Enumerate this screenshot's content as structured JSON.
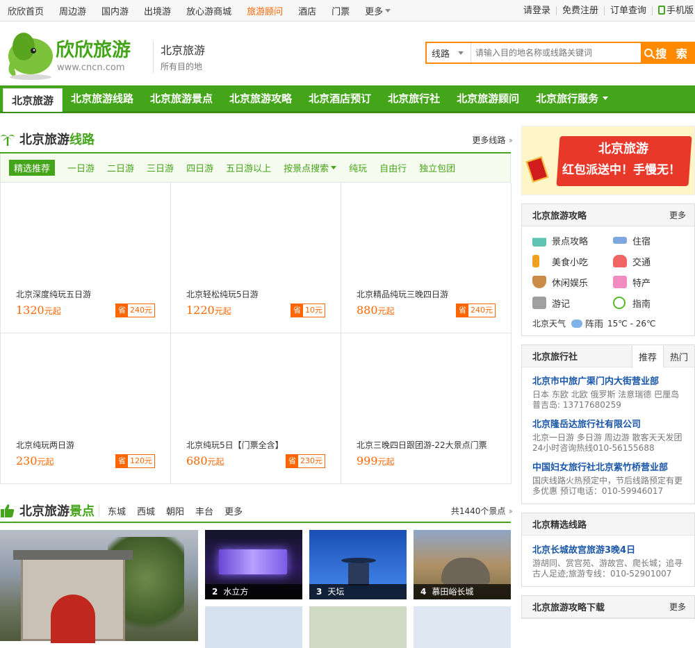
{
  "topnav": {
    "items": [
      "欣欣首页",
      "周边游",
      "国内游",
      "出境游",
      "放心游商城",
      "旅游顾问",
      "酒店",
      "门票"
    ],
    "highlight_index": 5,
    "more": "更多",
    "links": [
      "请登录",
      "免费注册",
      "订单查询",
      "手机版"
    ]
  },
  "header": {
    "logo_text": "欣欣旅游",
    "logo_url": "www.cncn.com",
    "city": "北京旅游",
    "city_sub": "所有目的地",
    "search_type": "线路",
    "search_placeholder": "请输入目的地名称或线路关键词",
    "search_button": "搜 索"
  },
  "mainnav": [
    "北京旅游",
    "北京旅游线路",
    "北京旅游景点",
    "北京旅游攻略",
    "北京酒店预订",
    "北京旅行社",
    "北京旅游顾问",
    "北京旅行服务"
  ],
  "routes": {
    "title_a": "北京旅游",
    "title_b": "线路",
    "more": "更多线路",
    "filters": [
      "精选推荐",
      "一日游",
      "二日游",
      "三日游",
      "四日游",
      "五日游以上",
      "按景点搜索",
      "纯玩",
      "自由行",
      "独立包团"
    ],
    "items": [
      {
        "name": "北京深度纯玩五日游",
        "price": "1320",
        "unit": "元起",
        "save_label": "省",
        "save": "240元"
      },
      {
        "name": "北京轻松纯玩5日游",
        "price": "1220",
        "unit": "元起",
        "save_label": "省",
        "save": "10元"
      },
      {
        "name": "北京精品纯玩三晚四日游",
        "price": "880",
        "unit": "元起",
        "save_label": "省",
        "save": "240元"
      },
      {
        "name": "北京纯玩两日游",
        "price": "230",
        "unit": "元起",
        "save_label": "省",
        "save": "120元"
      },
      {
        "name": "北京纯玩5日【门票全含】",
        "price": "680",
        "unit": "元起",
        "save_label": "省",
        "save": "230元"
      },
      {
        "name": "北京三晚四日跟团游-22大景点门票",
        "price": "999",
        "unit": "元起",
        "save_label": "",
        "save": ""
      }
    ]
  },
  "sights": {
    "title_a": "北京旅游",
    "title_b": "景点",
    "districts": [
      "东城",
      "西城",
      "朝阳",
      "丰台",
      "更多"
    ],
    "count": "共1440个景点",
    "thumbs": [
      {
        "num": "2",
        "name": "水立方"
      },
      {
        "num": "3",
        "name": "天坛"
      },
      {
        "num": "4",
        "name": "慕田峪长城"
      }
    ]
  },
  "banner": {
    "line1": "北京旅游",
    "line2": "红包派送中！手慢无！"
  },
  "guide_box": {
    "title": "北京旅游攻略",
    "more": "更多",
    "items": [
      "景点攻略",
      "住宿",
      "美食小吃",
      "交通",
      "休闲娱乐",
      "特产",
      "游记",
      "指南"
    ],
    "weather_label": "北京天气",
    "weather": "阵雨",
    "temp": "15℃ - 26℃"
  },
  "agency_box": {
    "title": "北京旅行社",
    "tabs": [
      "推荐",
      "热门"
    ],
    "items": [
      {
        "name": "北京市中旅广渠门内大街营业部",
        "desc": "日本 东欧 北欧 俄罗斯 法意瑞德 巴厘岛 普吉岛: 13717680259"
      },
      {
        "name": "北京隆岳达旅行社有限公司",
        "desc": "北京一日游 多日游 周边游 散客天天发团 24小时咨询热线010-56155688"
      },
      {
        "name": "中国妇女旅行社北京紫竹桥营业部",
        "desc": "国庆线路火热预定中，节后线路预定有更多优惠 预订电话：010-59946017"
      }
    ]
  },
  "route_box": {
    "title": "北京精选线路",
    "name": "北京长城故宫旅游3晚4日",
    "desc": "游胡同、赏宫苑、游故宫、爬长城；追寻古人足迹;旅游专线：010-52901007"
  },
  "download_box": {
    "title": "北京旅游攻略下载",
    "more": "更多"
  },
  "colors": {
    "brand_green": "#45a51a",
    "accent_orange": "#ff6600",
    "link_blue": "#1a56a8"
  }
}
